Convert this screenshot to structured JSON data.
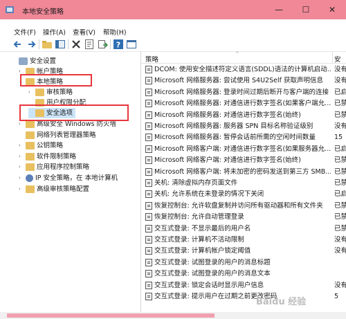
{
  "window": {
    "title": "本地安全策略",
    "minimize": "—",
    "maximize": "☐",
    "close": "✕"
  },
  "menu": [
    "文件(F)",
    "操作(A)",
    "查看(V)",
    "帮助(H)"
  ],
  "toolbar": [
    "back-icon",
    "forward-icon",
    "up-folder-icon",
    "show-tree-icon",
    "delete-icon",
    "properties-icon",
    "export-icon",
    "help-icon",
    "console-icon"
  ],
  "tree": [
    {
      "label": "安全设置",
      "level": 0,
      "expander": "",
      "icon": "security-settings-icon"
    },
    {
      "label": "帐户策略",
      "level": 1,
      "expander": "›",
      "icon": "folder-icon"
    },
    {
      "label": "本地策略",
      "level": 1,
      "expander": "⌄",
      "icon": "folder-icon"
    },
    {
      "label": "审核策略",
      "level": 2,
      "expander": "›",
      "icon": "folder-icon"
    },
    {
      "label": "用户权限分配",
      "level": 2,
      "expander": "",
      "icon": "folder-icon"
    },
    {
      "label": "安全选项",
      "level": 2,
      "expander": "",
      "icon": "folder-icon",
      "selected": true
    },
    {
      "label": "高级安全 Windows 防火墙",
      "level": 1,
      "expander": "›",
      "icon": "folder-icon"
    },
    {
      "label": "网络列表管理器策略",
      "level": 1,
      "expander": "",
      "icon": "folder-icon"
    },
    {
      "label": "公钥策略",
      "level": 1,
      "expander": "›",
      "icon": "folder-icon"
    },
    {
      "label": "软件限制策略",
      "level": 1,
      "expander": "›",
      "icon": "folder-icon"
    },
    {
      "label": "应用程序控制策略",
      "level": 1,
      "expander": "›",
      "icon": "folder-icon"
    },
    {
      "label": "IP 安全策略，在 本地计算机",
      "level": 1,
      "expander": "›",
      "icon": "ip-security-icon"
    },
    {
      "label": "高级审核策略配置",
      "level": 1,
      "expander": "›",
      "icon": "folder-icon"
    }
  ],
  "columns": {
    "policy": "策略",
    "setting": "安"
  },
  "policies": [
    {
      "name": "DCOM: 使用安全描述符定义语言(SDDL)语法的计算机启动...",
      "value": "没有"
    },
    {
      "name": "Microsoft 网络服务器: 尝试使用 S4U2Self 获取声明信息",
      "value": "没有"
    },
    {
      "name": "Microsoft 网络服务器: 登录时间过期后断开与客户端的连接",
      "value": "已启"
    },
    {
      "name": "Microsoft 网络服务器: 对通信进行数字签名(如果客户端允...",
      "value": "已禁"
    },
    {
      "name": "Microsoft 网络服务器: 对通信进行数字签名(始终)",
      "value": "已禁"
    },
    {
      "name": "Microsoft 网络服务器: 服务器 SPN 目标名称验证级别",
      "value": "没有"
    },
    {
      "name": "Microsoft 网络服务器: 暂停会话前所需的空闲时间数量",
      "value": "15"
    },
    {
      "name": "Microsoft 网络客户端: 对通信进行数字签名(如果服务器允...",
      "value": "已启"
    },
    {
      "name": "Microsoft 网络客户端: 对通信进行数字签名(始终)",
      "value": "已禁"
    },
    {
      "name": "Microsoft 网络客户端: 将未加密的密码发送到第三方 SMB...",
      "value": "已禁"
    },
    {
      "name": "关机: 清除虚拟内存页面文件",
      "value": "已禁"
    },
    {
      "name": "关机: 允许系统在未登录的情况下关闭",
      "value": "已启"
    },
    {
      "name": "恢复控制台: 允许软盘复制并访问所有驱动器和所有文件夹",
      "value": "已禁"
    },
    {
      "name": "恢复控制台: 允许自动管理登录",
      "value": "已禁"
    },
    {
      "name": "交互式登录: 不显示最后的用户名",
      "value": "已禁"
    },
    {
      "name": "交互式登录: 计算机不活动限制",
      "value": "没有"
    },
    {
      "name": "交互式登录: 计算机帐户锁定阈值",
      "value": "没有"
    },
    {
      "name": "交互式登录: 试图登录的用户的消息标题",
      "value": ""
    },
    {
      "name": "交互式登录: 试图登录的用户的消息文本",
      "value": ""
    },
    {
      "name": "交互式登录: 锁定会话时显示用户信息",
      "value": "没有"
    },
    {
      "name": "交互式登录: 提示用户在过期之前更改密码",
      "value": "5"
    }
  ],
  "watermark": "Baidu 经验",
  "colors": {
    "titlebar": "#f08898",
    "highlight_box": "#e8343c",
    "folder": "#e8c060"
  }
}
